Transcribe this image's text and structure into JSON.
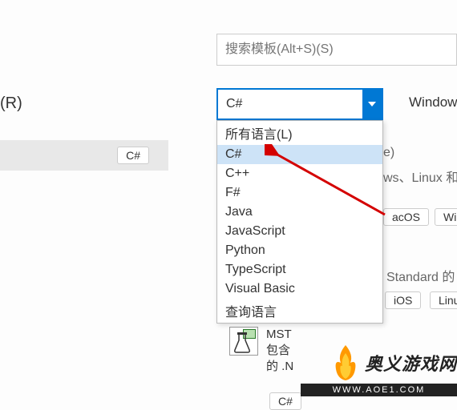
{
  "left": {
    "recent_label": "(R)",
    "tag": "C#"
  },
  "search": {
    "placeholder": "搜索模板(Alt+S)(S)"
  },
  "lang_select": {
    "value": "C#"
  },
  "dropdown": {
    "items": [
      "所有语言(L)",
      "C#",
      "C++",
      "F#",
      "Java",
      "JavaScript",
      "Python",
      "TypeScript",
      "Visual Basic",
      "查询语言"
    ],
    "selected_index": 1
  },
  "platform_label": "Window",
  "bg": {
    "line1_frag": "e)",
    "line2_frag": "ws、Linux 和",
    "tag_macos": "acOS",
    "tag_win": "Wi",
    "line3_frag": "Standard 的",
    "tag_ios": "iOS",
    "tag_linux": "Linu"
  },
  "mst": {
    "title": "MST",
    "line1": "包含",
    "line2": "的 .N",
    "tag": "C#"
  },
  "watermark": {
    "text": "奥义游戏网",
    "url": "WWW.AOE1.COM"
  }
}
